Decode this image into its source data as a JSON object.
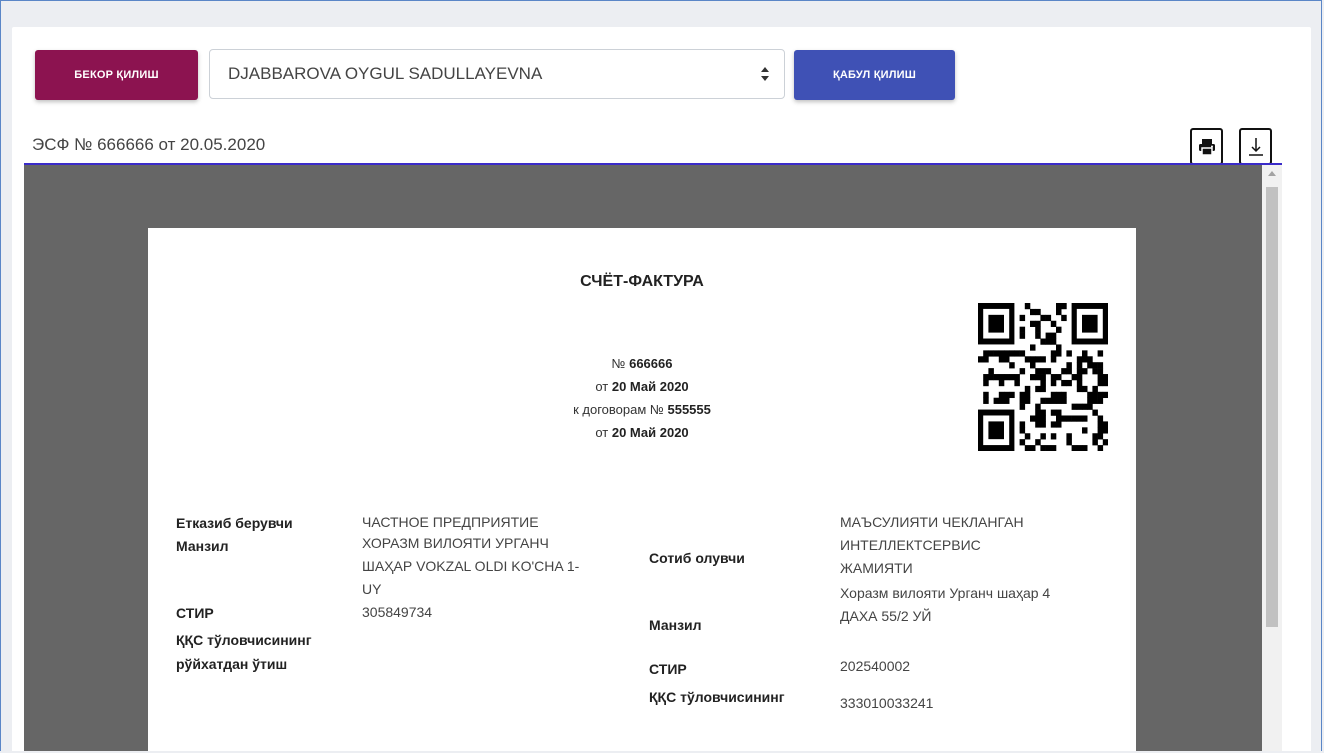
{
  "toolbar": {
    "cancel_label": "БЕКОР ҚИЛИШ",
    "accept_label": "ҚАБУЛ ҚИЛИШ",
    "signer_selected": "DJABBAROVA OYGUL SADULLAYEVNA"
  },
  "document": {
    "title": "ЭСФ № 666666 от 20.05.2020"
  },
  "invoice": {
    "heading": "СЧЁТ-ФАКТУРА",
    "number_prefix": "№",
    "number": "666666",
    "date_prefix": "от",
    "date": "20 Май 2020",
    "contract_prefix": "к договорам №",
    "contract_number": "555555",
    "contract_date_prefix": "от",
    "contract_date": "20 Май 2020",
    "seller": {
      "label": "Етказиб берувчи",
      "value": "ЧАСТНОЕ ПРЕДПРИЯТИЕ",
      "address_label": "Манзил",
      "address_line1": "ХОРАЗМ ВИЛОЯТИ УРГАНЧ",
      "address_line2": "ШАҲАР VOKZAL OLDI KO'CHA 1-",
      "address_line3": "UY",
      "tin_label": "СТИР",
      "tin_value": "305849734",
      "vat_label_line1": "ҚҚС тўловчисининг",
      "vat_label_line2": "рўйхатдан ўтиш"
    },
    "buyer": {
      "label": "Сотиб олувчи",
      "name_line1": "МАЪСУЛИЯТИ ЧЕКЛАНГАН",
      "name_line2": "ИНТЕЛЛЕКТСЕРВИС",
      "name_line3": "ЖАМИЯТИ",
      "address_label": "Манзил",
      "address_line1": "Хоразм вилояти Урганч шаҳар 4",
      "address_line2": "ДАХА 55/2 УЙ",
      "tin_label": "СТИР",
      "tin_value": "202540002",
      "vat_label_line1": "ҚҚС тўловчисининг",
      "vat_value": "333010033241"
    }
  },
  "colors": {
    "cancel": "#8c1350",
    "accept": "#3f51b5",
    "divider": "#3a2bc9",
    "viewer_bg": "#666666"
  },
  "icons": [
    "chevron-updown-icon",
    "print-icon",
    "download-icon",
    "qr-code-icon"
  ]
}
